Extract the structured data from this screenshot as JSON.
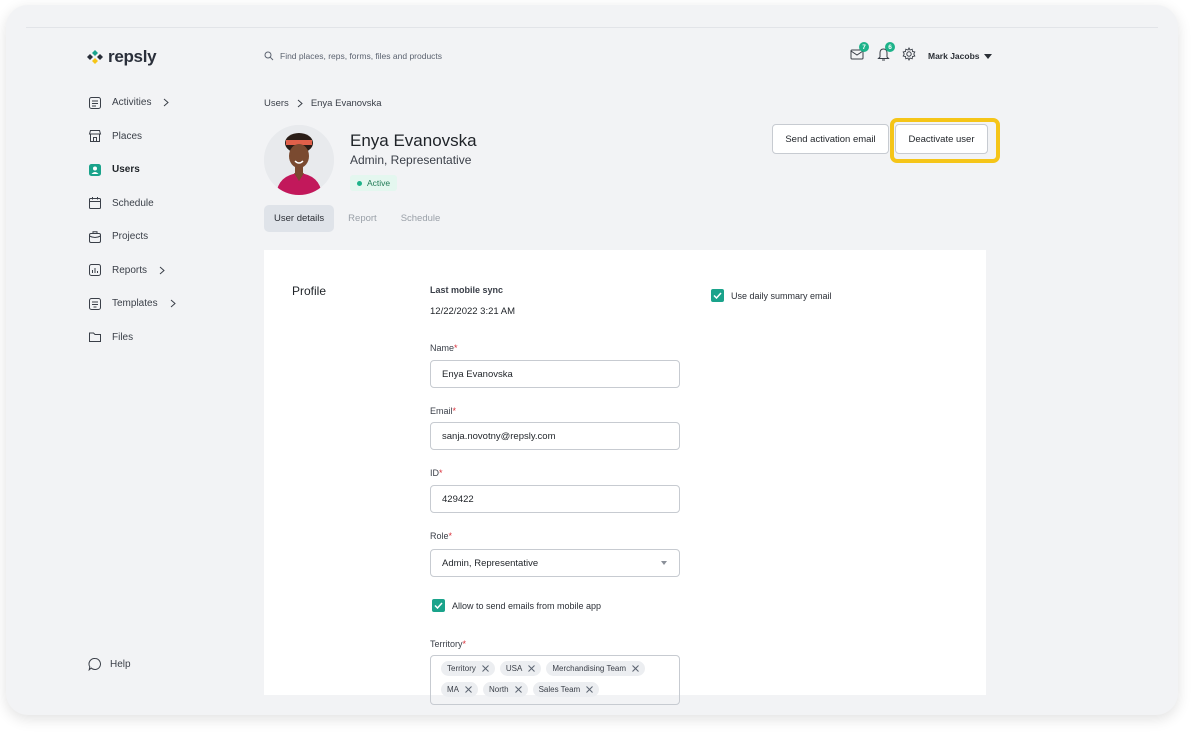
{
  "app": {
    "brand": "repsly",
    "brand_color": "#1aa38b",
    "accent_highlight": "#f5c518"
  },
  "header": {
    "search_placeholder": "Find places, reps, forms, files and products",
    "messages_count": "7",
    "notifications_count": "6",
    "user_name": "Mark Jacobs"
  },
  "sidebar": {
    "items": [
      {
        "label": "Activities",
        "icon": "activities-icon"
      },
      {
        "label": "Places",
        "icon": "store-icon"
      },
      {
        "label": "Users",
        "icon": "user-icon"
      },
      {
        "label": "Schedule",
        "icon": "calendar-icon"
      },
      {
        "label": "Projects",
        "icon": "briefcase-icon"
      },
      {
        "label": "Reports",
        "icon": "chart-icon"
      },
      {
        "label": "Templates",
        "icon": "template-icon"
      },
      {
        "label": "Files",
        "icon": "folder-icon"
      }
    ],
    "help_label": "Help"
  },
  "breadcrumb": {
    "parent": "Users",
    "current": "Enya Evanovska"
  },
  "user": {
    "name": "Enya Evanovska",
    "roles": "Admin, Representative",
    "status": "Active"
  },
  "actions": {
    "send_activation": "Send activation email",
    "deactivate": "Deactivate user"
  },
  "tabs": [
    "User details",
    "Report",
    "Schedule"
  ],
  "profile": {
    "section_title": "Profile",
    "last_sync_label": "Last mobile sync",
    "last_sync_value": "12/22/2022 3:21 AM",
    "name_label": "Name",
    "name_value": "Enya Evanovska",
    "email_label": "Email",
    "email_value": "sanja.novotny@repsly.com",
    "id_label": "ID",
    "id_value": "429422",
    "role_label": "Role",
    "role_value": "Admin, Representative",
    "allow_emails_label": "Allow to send emails from mobile app",
    "daily_summary_label": "Use daily summary email",
    "territory_label": "Territory",
    "territory_tags": [
      "Territory",
      "USA",
      "Merchandising Team",
      "MA",
      "North",
      "Sales Team"
    ]
  }
}
